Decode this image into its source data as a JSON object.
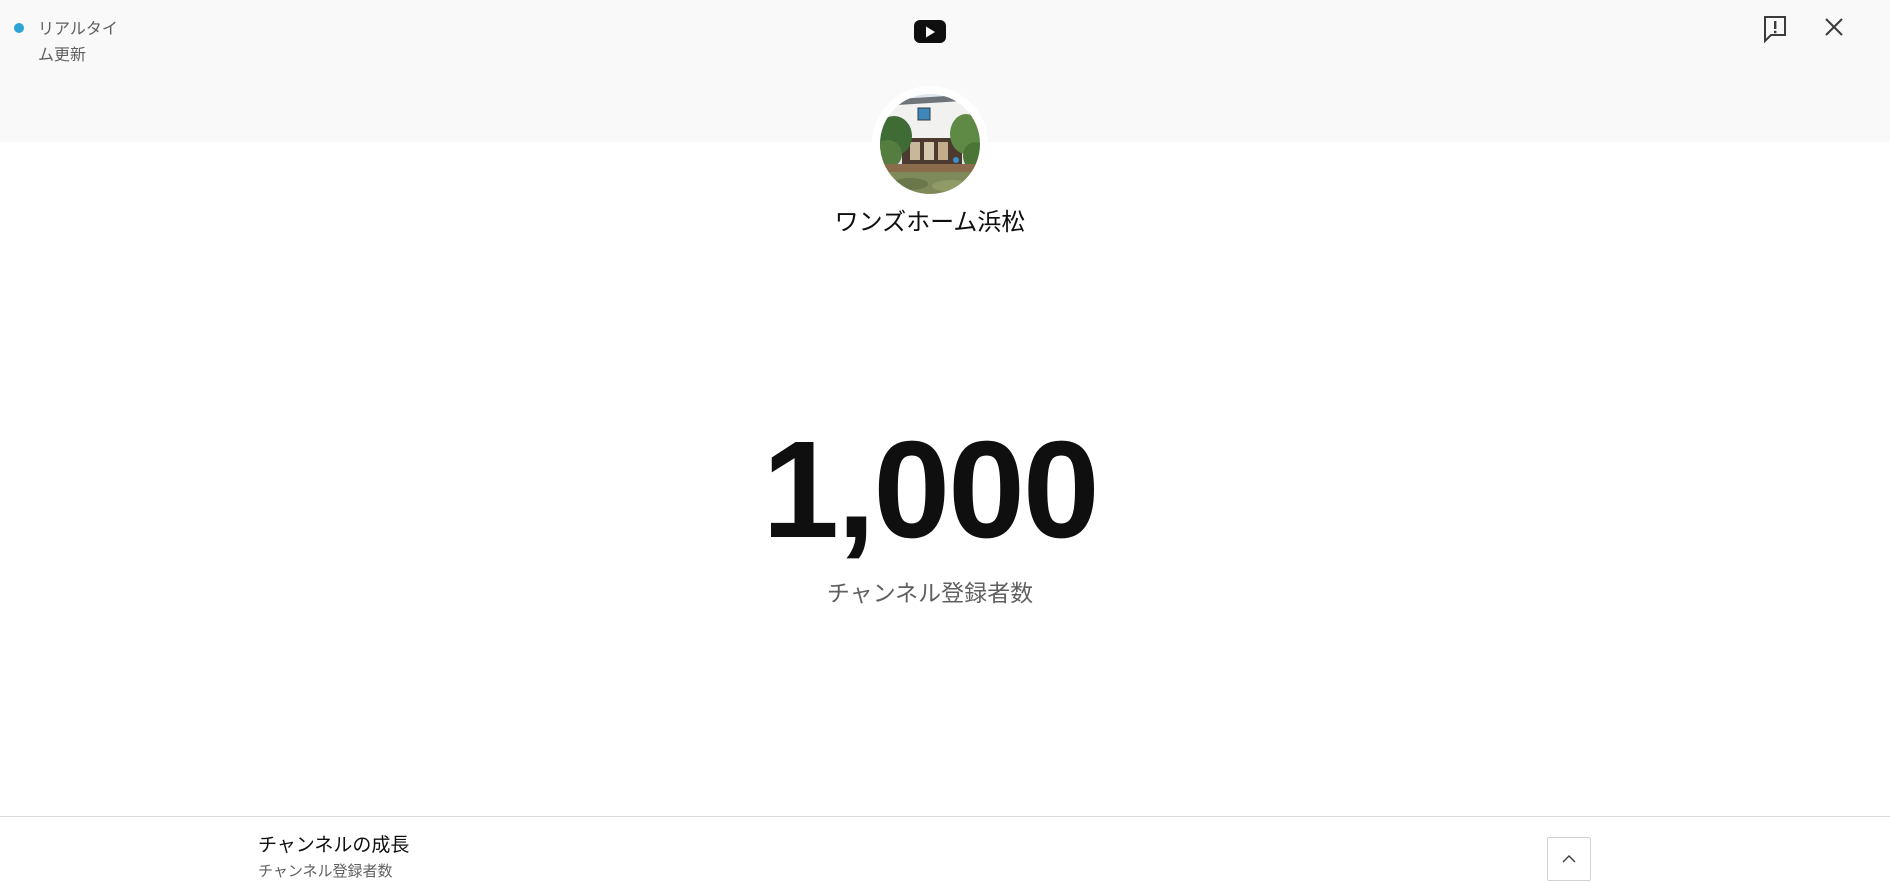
{
  "realtime": {
    "label": "リアルタイム更新",
    "dot_color": "#2ba3d4"
  },
  "header": {
    "logo_icon": "youtube-play-icon",
    "logo_color": "#0f0f0f",
    "report_icon": "report-flag-icon",
    "close_icon": "close-icon"
  },
  "channel": {
    "name": "ワンズホーム浜松",
    "avatar_icon": "channel-avatar-house-photo"
  },
  "stats": {
    "subscriber_count": "1,000",
    "subscriber_label": "チャンネル登録者数"
  },
  "growth": {
    "title": "チャンネルの成長",
    "subtitle": "チャンネル登録者数",
    "collapse_icon": "chevron-up-icon"
  },
  "colors": {
    "top_band": "#f9f9f9",
    "text_primary": "#0f0f0f",
    "text_secondary": "#606060"
  }
}
